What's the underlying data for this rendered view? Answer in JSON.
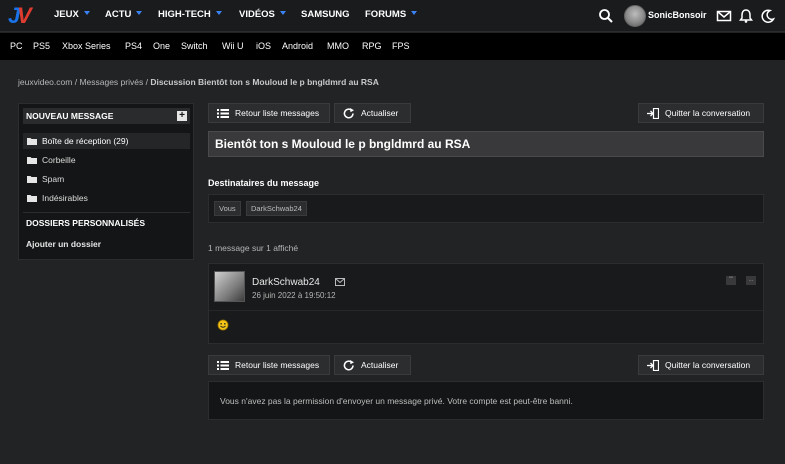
{
  "nav": {
    "items": [
      {
        "label": "JEUX",
        "caret": true
      },
      {
        "label": "ACTU",
        "caret": true
      },
      {
        "label": "HIGH-TECH",
        "caret": true
      },
      {
        "label": "VIDÉOS",
        "caret": true
      },
      {
        "label": "SAMSUNG",
        "caret": false
      },
      {
        "label": "FORUMS",
        "caret": true
      }
    ],
    "username": "SonicBonsoir",
    "icons": [
      "search-icon",
      "mail-icon",
      "bell-icon",
      "moon-icon"
    ],
    "accent": "#3b82f6"
  },
  "platforms": [
    "PC",
    "PS5",
    "Xbox Series",
    "PS4",
    "One",
    "Switch",
    "Wii U",
    "iOS",
    "Android",
    "MMO",
    "RPG",
    "FPS"
  ],
  "breadcrumb": {
    "part1": "jeuxvideo.com",
    "sep": " / ",
    "part2": "Messages privés",
    "current": "Discussion Bientôt ton s Mouloud le p bngldmrd au RSA"
  },
  "sidebar": {
    "new_message": "NOUVEAU MESSAGE",
    "plus": "+",
    "folders": [
      {
        "label": "Boîte de réception (29)",
        "active": true
      },
      {
        "label": "Corbeille",
        "active": false
      },
      {
        "label": "Spam",
        "active": false
      },
      {
        "label": "Indésirables",
        "active": false
      }
    ],
    "personal_title": "DOSSIERS PERSONNALISÉS",
    "add_folder": "Ajouter un dossier"
  },
  "toolbar": {
    "back": "Retour liste messages",
    "refresh": "Actualiser",
    "quit": "Quitter la conversation"
  },
  "conversation": {
    "title": "Bientôt ton s Mouloud le p bngldmrd au RSA",
    "recipients_label": "Destinataires du message",
    "recipients": [
      "Vous",
      "DarkSchwab24"
    ],
    "count": "1 message sur 1 affiché"
  },
  "message": {
    "author": "DarkSchwab24",
    "date": "26 juin 2022 à 19:50:12",
    "quote_btn": "\"\"",
    "more_btn": "..."
  },
  "notice": "Vous n'avez pas la permission d'envoyer un message privé. Votre compte est peut-être banni."
}
